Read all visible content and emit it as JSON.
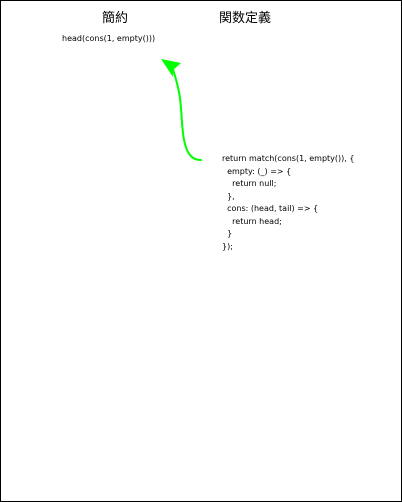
{
  "headings": {
    "left": "簡約",
    "right": "関数定義"
  },
  "expression": "head(cons(1, empty()))",
  "code_lines": [
    "return match(cons(1, empty()), {",
    "  empty: (_) => {",
    "    return null;",
    "  },",
    "  cons: (head, tail) => {",
    "    return head;",
    "  }",
    "});"
  ],
  "colors": {
    "arrow": "#00ff00",
    "text": "#000000",
    "border": "#000000",
    "background": "#ffffff"
  },
  "icons": {
    "connector": "curved-arrow-icon"
  }
}
